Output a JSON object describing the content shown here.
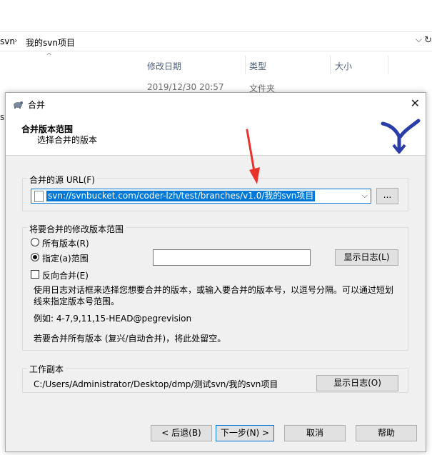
{
  "explorer": {
    "breadcrumb": [
      "svn",
      "我的svn项目"
    ],
    "columns": [
      "修改日期",
      "类型",
      "大小"
    ],
    "row": {
      "date": "2019/12/30 20:57",
      "type": "文件夹"
    },
    "edge_char": "s"
  },
  "dialog": {
    "title": "合并",
    "header_title": "合并版本范围",
    "header_subtitle": "选择合并的版本",
    "source": {
      "group_label": "合并的源 URL(F)",
      "url": "svn://svnbucket.com/coder-lzh/test/branches/v1.0/我的svn项目",
      "browse_label": "..."
    },
    "range": {
      "group_label": "将要合并的修改版本范围",
      "all_revisions": "所有版本(R)",
      "specific_range": "指定(a)范围",
      "selected": "specific_range",
      "range_value": "",
      "show_log": "显示日志(L)",
      "reverse_merge": "反向合并(E)",
      "reverse_checked": false,
      "help_text": "使用日志对话框来选择您想要合并的版本，或输入要合并的版本号，以逗号分隔。可以通过短划线来指定版本号范围。",
      "example": "例如: 4-7,9,11,15-HEAD@pegrevision",
      "note": "若要合并所有版本 (复兴/自动合并)，将此处留空。"
    },
    "working_copy": {
      "group_label": "工作副本",
      "path": "C:/Users/Administrator/Desktop/dmp/测试svn/我的svn项目",
      "show_log": "显示日志(O)"
    },
    "buttons": {
      "back": "< 后退(B)",
      "next": "下一步(N) >",
      "cancel": "取消",
      "help": "帮助"
    }
  },
  "colors": {
    "accent": "#0078d7",
    "annotation_arrow": "#e8322d",
    "logo_blue": "#2b3ea8"
  }
}
